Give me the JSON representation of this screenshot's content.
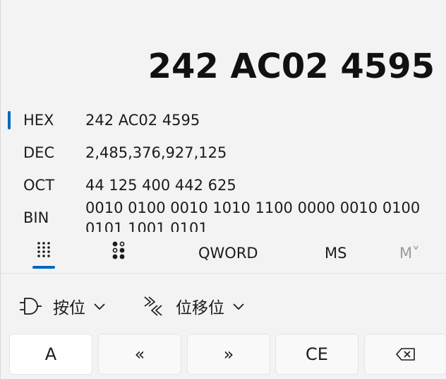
{
  "display": {
    "top_clipped_text": "— ^ …",
    "value": "242 AC02 4595"
  },
  "radix": [
    {
      "name": "HEX",
      "value": "242 AC02 4595",
      "selected": true
    },
    {
      "name": "DEC",
      "value": "2,485,376,927,125",
      "selected": false
    },
    {
      "name": "OCT",
      "value": "44 125 400 442 625",
      "selected": false
    },
    {
      "name": "BIN",
      "value": "0010 0100 0010 1010 1100 0000 0010 0100 0101 1001 0101",
      "selected": false
    }
  ],
  "modes": {
    "keypad_icon": "keypad-grid-icon",
    "bitflip_icon": "bit-toggle-icon",
    "word_size": "QWORD",
    "ms": "MS",
    "m_dropdown": "M˅"
  },
  "dropdowns": {
    "bitwise": {
      "icon": "logic-gate-icon",
      "label": "按位"
    },
    "bitshift": {
      "icon": "bitshift-icon",
      "label": "位移位"
    }
  },
  "keys": [
    "A",
    "«",
    "»",
    "CE",
    "⌫"
  ],
  "colors": {
    "accent": "#0067c0",
    "background": "#f3f3f3",
    "key_background": "#f9f9f9",
    "key_white": "#ffffff"
  }
}
